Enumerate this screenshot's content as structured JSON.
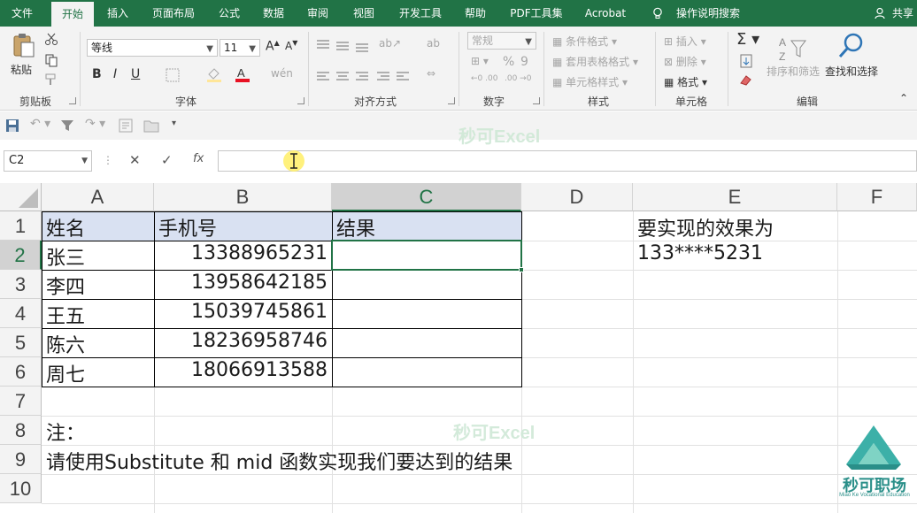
{
  "tabs": [
    "文件",
    "开始",
    "插入",
    "页面布局",
    "公式",
    "数据",
    "审阅",
    "视图",
    "开发工具",
    "帮助",
    "PDF工具集",
    "Acrobat",
    "操作说明搜索"
  ],
  "share": "共享",
  "ribbon": {
    "paste": "粘贴",
    "clipboard": "剪贴板",
    "font_name": "等线",
    "font_size": "11",
    "font_group": "字体",
    "align_group": "对齐方式",
    "number_format": "常规",
    "number_group": "数字",
    "cond_format": "条件格式",
    "table_format": "套用表格格式",
    "cell_style": "单元格样式",
    "styles_group": "样式",
    "insert": "插入",
    "delete": "删除",
    "format": "格式",
    "cells_group": "单元格",
    "sort_filter": "排序和筛选",
    "find_select": "查找和选择",
    "edit_group": "编辑",
    "colors": {
      "font_red": "#e81123",
      "ribbon_green": "#217346"
    }
  },
  "formula_bar": {
    "name_box": "C2",
    "formula": ""
  },
  "watermark": "秒可Excel",
  "logo": {
    "text": "秒可职场",
    "sub": "Miao Ke Vocational Education"
  },
  "sheet": {
    "columns": [
      "A",
      "B",
      "C",
      "D",
      "E",
      "F"
    ],
    "rows": [
      "1",
      "2",
      "3",
      "4",
      "5",
      "6",
      "7",
      "8",
      "9",
      "10"
    ],
    "header": {
      "a": "姓名",
      "b": "手机号",
      "c": "结果"
    },
    "data": [
      {
        "name": "张三",
        "phone": "13388965231"
      },
      {
        "name": "李四",
        "phone": "13958642185"
      },
      {
        "name": "王五",
        "phone": "15039745861"
      },
      {
        "name": "陈六",
        "phone": "18236958746"
      },
      {
        "name": "周七",
        "phone": "18066913588"
      }
    ],
    "e1": "要实现的效果为",
    "e2": "133****5231",
    "a8": "注：",
    "a9": "请使用Substitute 和 mid 函数实现我们要达到的结果"
  }
}
